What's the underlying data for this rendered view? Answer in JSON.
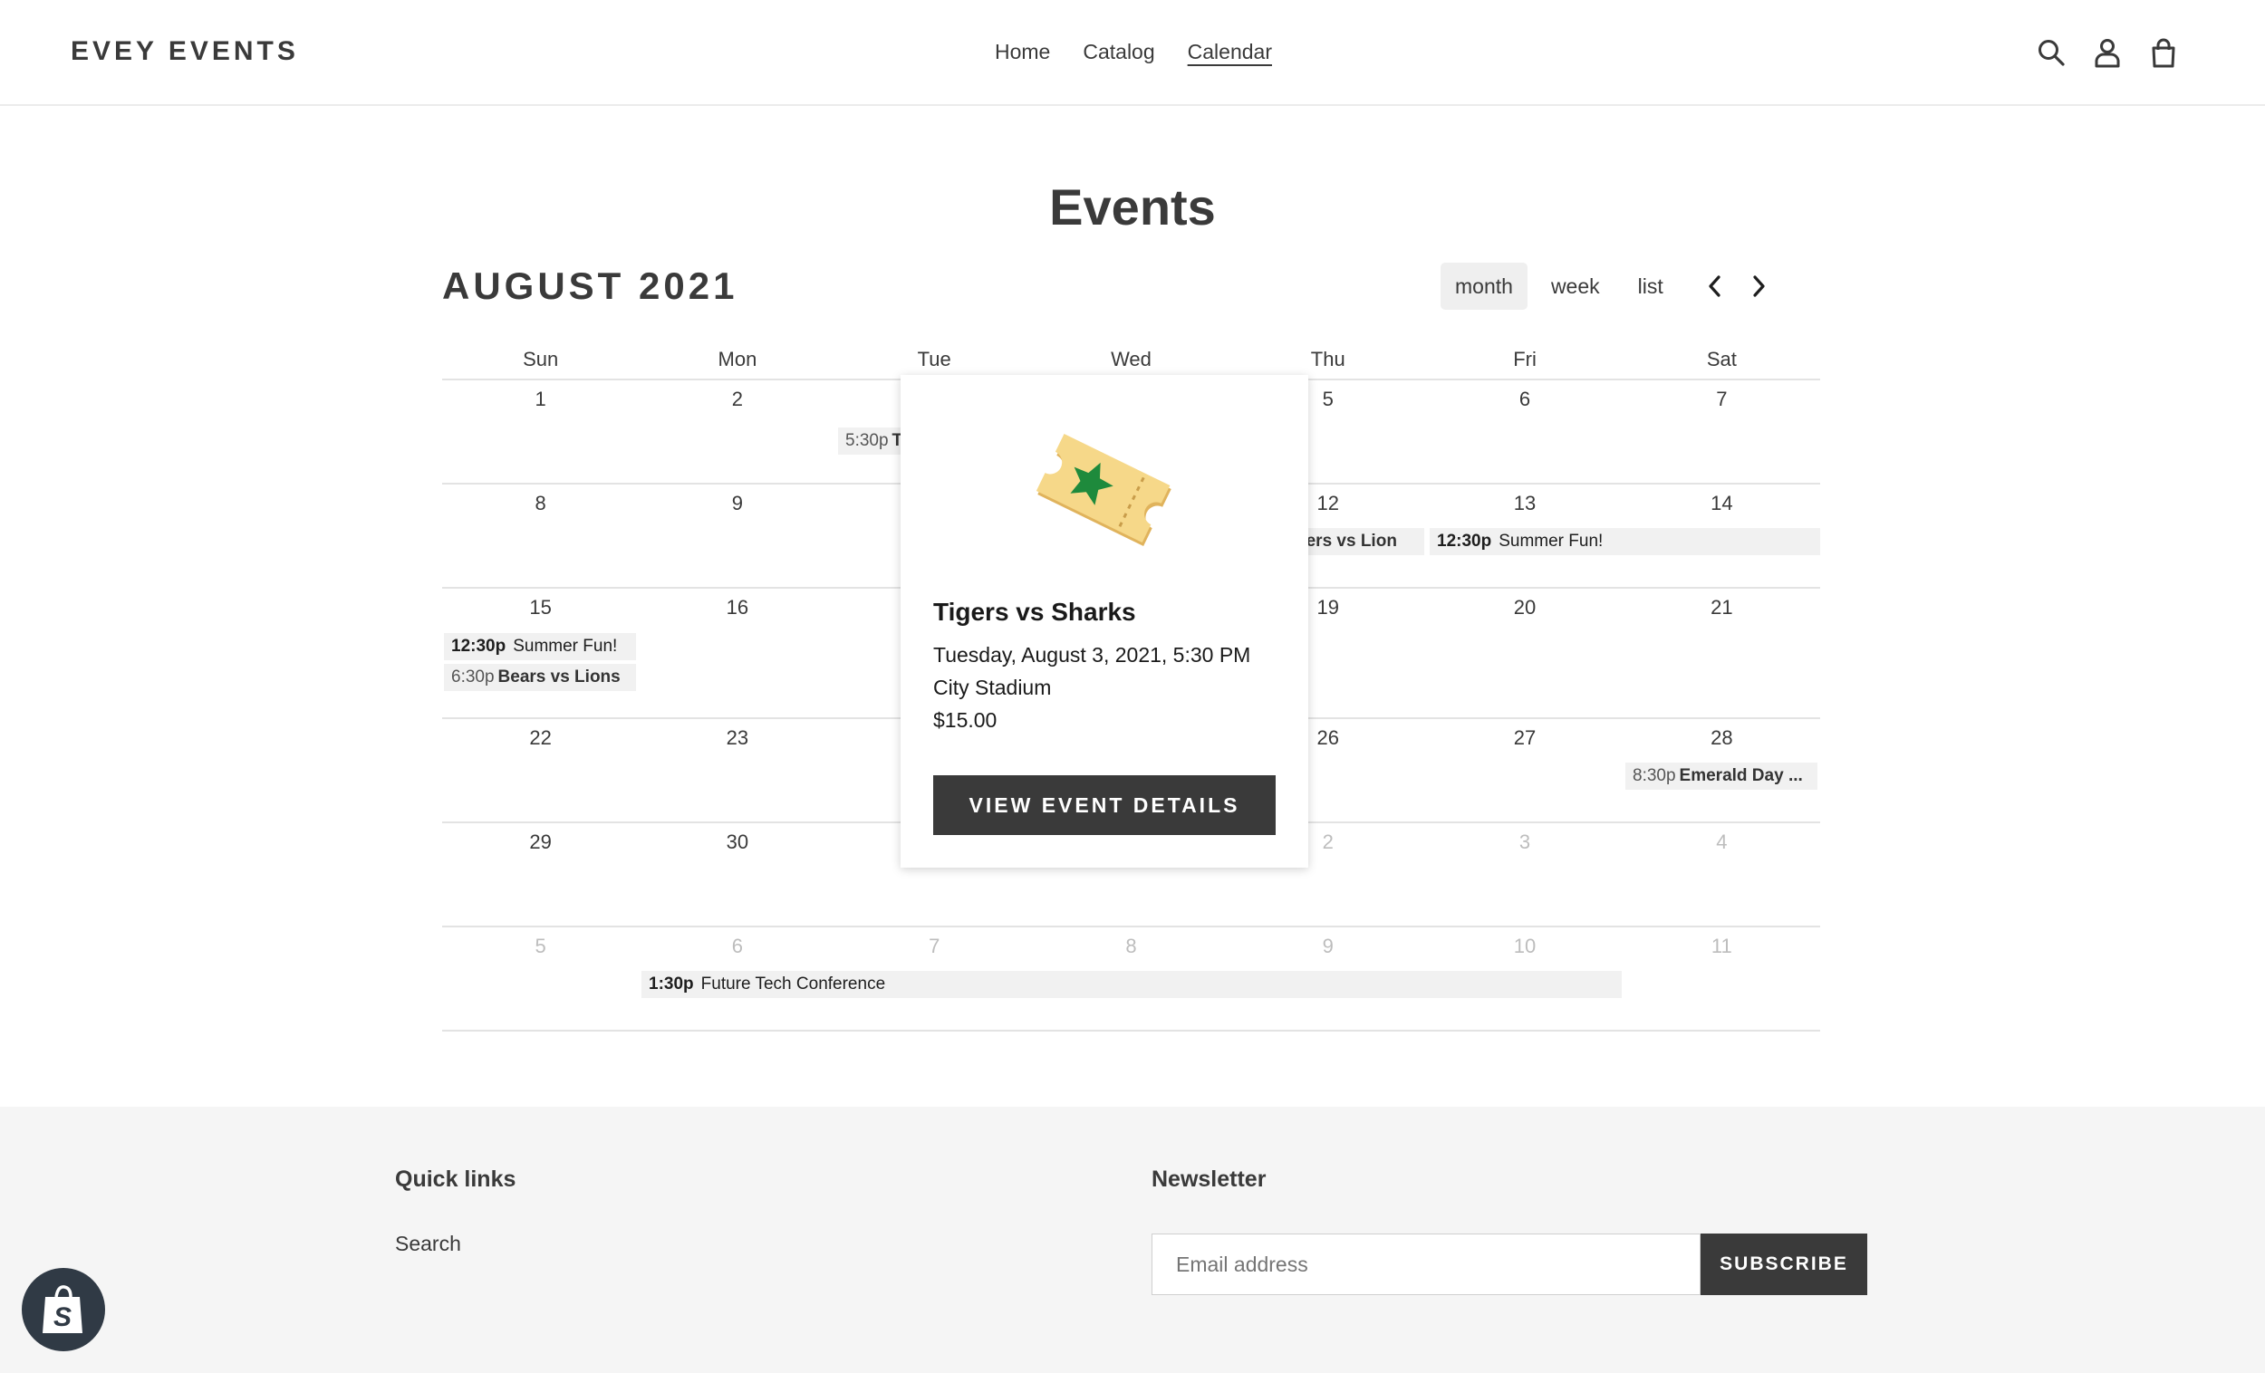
{
  "header": {
    "logo": "EVEY EVENTS",
    "nav": [
      "Home",
      "Catalog",
      "Calendar"
    ]
  },
  "page": {
    "title": "Events"
  },
  "calendar": {
    "month": "AUGUST 2021",
    "views": [
      "month",
      "week",
      "list"
    ],
    "days": [
      "Sun",
      "Mon",
      "Tue",
      "Wed",
      "Thu",
      "Fri",
      "Sat"
    ],
    "weeks": [
      [
        "1",
        "2",
        "",
        "",
        "5",
        "6",
        "7"
      ],
      [
        "8",
        "9",
        "",
        "",
        "12",
        "13",
        "14"
      ],
      [
        "15",
        "16",
        "",
        "",
        "19",
        "20",
        "21"
      ],
      [
        "22",
        "23",
        "",
        "",
        "26",
        "27",
        "28"
      ],
      [
        "29",
        "30",
        "",
        "",
        "2",
        "3",
        "4"
      ],
      [
        "5",
        "6",
        "7",
        "8",
        "9",
        "10",
        "11"
      ]
    ],
    "events": {
      "w1_tue": {
        "time": "5:30p",
        "name": "T"
      },
      "w2_thu": {
        "name": "gers vs Lion"
      },
      "w2_fri": {
        "time": "12:30p",
        "name": "Summer Fun!"
      },
      "w3_sun_a": {
        "time": "12:30p",
        "name": "Summer Fun!"
      },
      "w3_sun_b": {
        "time": "6:30p",
        "name": "Bears vs Lions"
      },
      "w4_sat": {
        "time": "8:30p",
        "name": "Emerald Day ..."
      },
      "w6_mon": {
        "time": "1:30p",
        "name": "Future Tech Conference"
      }
    }
  },
  "popup": {
    "title": "Tigers vs Sharks",
    "datetime": "Tuesday, August 3, 2021, 5:30 PM",
    "venue": "City Stadium",
    "price": "$15.00",
    "button": "VIEW EVENT DETAILS"
  },
  "footer": {
    "quick_links_title": "Quick links",
    "link_search": "Search",
    "newsletter_title": "Newsletter",
    "email_placeholder": "Email address",
    "subscribe": "SUBSCRIBE"
  }
}
